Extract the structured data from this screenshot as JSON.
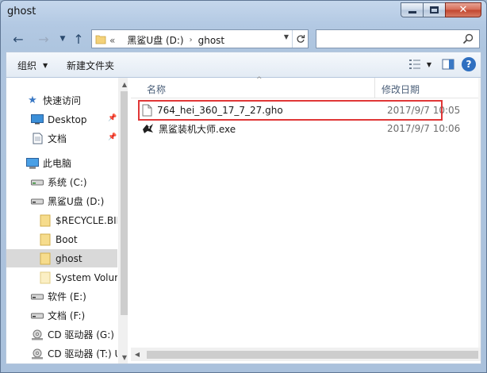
{
  "window": {
    "title": "ghost"
  },
  "address": {
    "overflow": "«",
    "crumbs": [
      "黑鲨U盘 (D:)",
      "ghost"
    ]
  },
  "search": {
    "placeholder": ""
  },
  "commandbar": {
    "organize": "组织",
    "new_folder": "新建文件夹"
  },
  "nav": {
    "items": [
      {
        "label": "快速访问",
        "icon": "star-icon",
        "pinned": false
      },
      {
        "label": "Desktop",
        "icon": "desktop-icon",
        "pinned": true
      },
      {
        "label": "文档",
        "icon": "document-icon",
        "pinned": true
      },
      {
        "label": "此电脑",
        "icon": "computer-icon",
        "pinned": false
      },
      {
        "label": "系统 (C:)",
        "icon": "drive-icon",
        "pinned": false
      },
      {
        "label": "黑鲨U盘 (D:)",
        "icon": "usb-drive-icon",
        "pinned": false
      },
      {
        "label": "$RECYCLE.BIN",
        "icon": "folder-icon",
        "pinned": false
      },
      {
        "label": "Boot",
        "icon": "folder-icon",
        "pinned": false
      },
      {
        "label": "ghost",
        "icon": "folder-icon",
        "pinned": false,
        "selected": true
      },
      {
        "label": "System Volume Information",
        "icon": "folder-icon",
        "pinned": false
      },
      {
        "label": "软件 (E:)",
        "icon": "drive-icon",
        "pinned": false
      },
      {
        "label": "文档 (F:)",
        "icon": "drive-icon",
        "pinned": false
      },
      {
        "label": "CD 驱动器 (G:)",
        "icon": "cd-drive-icon",
        "pinned": false
      },
      {
        "label": "CD 驱动器 (T:) U",
        "icon": "cd-drive-icon",
        "pinned": false
      }
    ]
  },
  "content": {
    "columns": {
      "name": "名称",
      "modified": "修改日期"
    },
    "files": [
      {
        "name": "764_hei_360_17_7_27.gho",
        "modified": "2017/9/7 10:05",
        "icon": "file-icon",
        "highlighted": true
      },
      {
        "name": "黑鲨装机大师.exe",
        "modified": "2017/9/7 10:06",
        "icon": "exe-icon",
        "highlighted": false
      }
    ]
  },
  "colors": {
    "highlight_border": "#e03737",
    "selected_bg": "#d9d9d9"
  }
}
